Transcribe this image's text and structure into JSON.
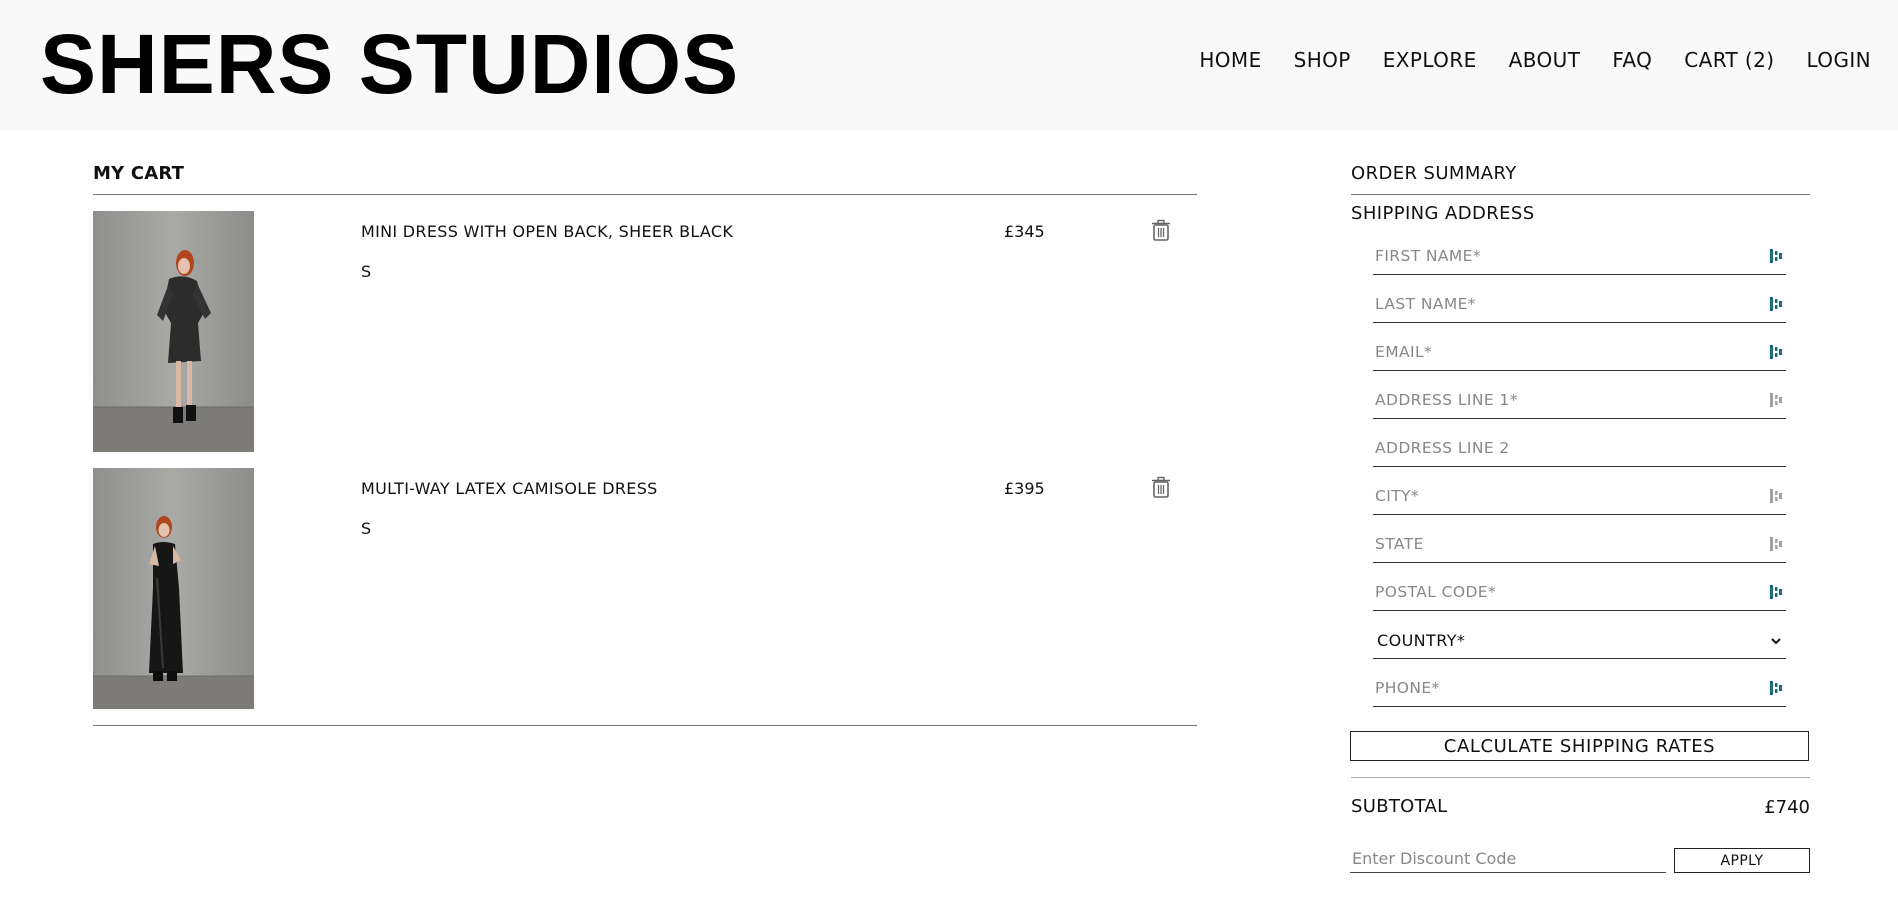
{
  "brand": {
    "logo_text": "SHERS STUDIOS"
  },
  "nav": {
    "items": [
      "HOME",
      "SHOP",
      "EXPLORE",
      "ABOUT",
      "FAQ",
      "CART (2)",
      "LOGIN"
    ]
  },
  "cart": {
    "title": "MY CART",
    "items": [
      {
        "name": "MINI DRESS WITH OPEN BACK, SHEER BLACK",
        "size": "S",
        "price": "£345",
        "image": "model-in-mini-dress-photo",
        "delete_icon": "trash-icon"
      },
      {
        "name": "MULTI-WAY LATEX CAMISOLE DRESS",
        "size": "S",
        "price": "£395",
        "image": "model-in-long-latex-dress-photo",
        "delete_icon": "trash-icon"
      }
    ]
  },
  "summary": {
    "title": "ORDER SUMMARY",
    "shipping_title": "SHIPPING ADDRESS",
    "fields": {
      "first_name": "FIRST NAME*",
      "last_name": "LAST NAME*",
      "email": "EMAIL*",
      "address1": "ADDRESS LINE 1*",
      "address2": "ADDRESS LINE 2",
      "city": "CITY*",
      "state": "STATE",
      "postal": "POSTAL CODE*",
      "country": "COUNTRY*",
      "phone": "PHONE*"
    },
    "calculate_label": "CALCULATE SHIPPING RATES",
    "subtotal_label": "SUBTOTAL",
    "subtotal_value": "£740",
    "discount_placeholder": "Enter Discount Code",
    "apply_label": "APPLY"
  },
  "colors": {
    "autofill_icon_active": "#1e6a7a",
    "autofill_icon_muted": "#a0a0a0",
    "rule": "#777777"
  }
}
